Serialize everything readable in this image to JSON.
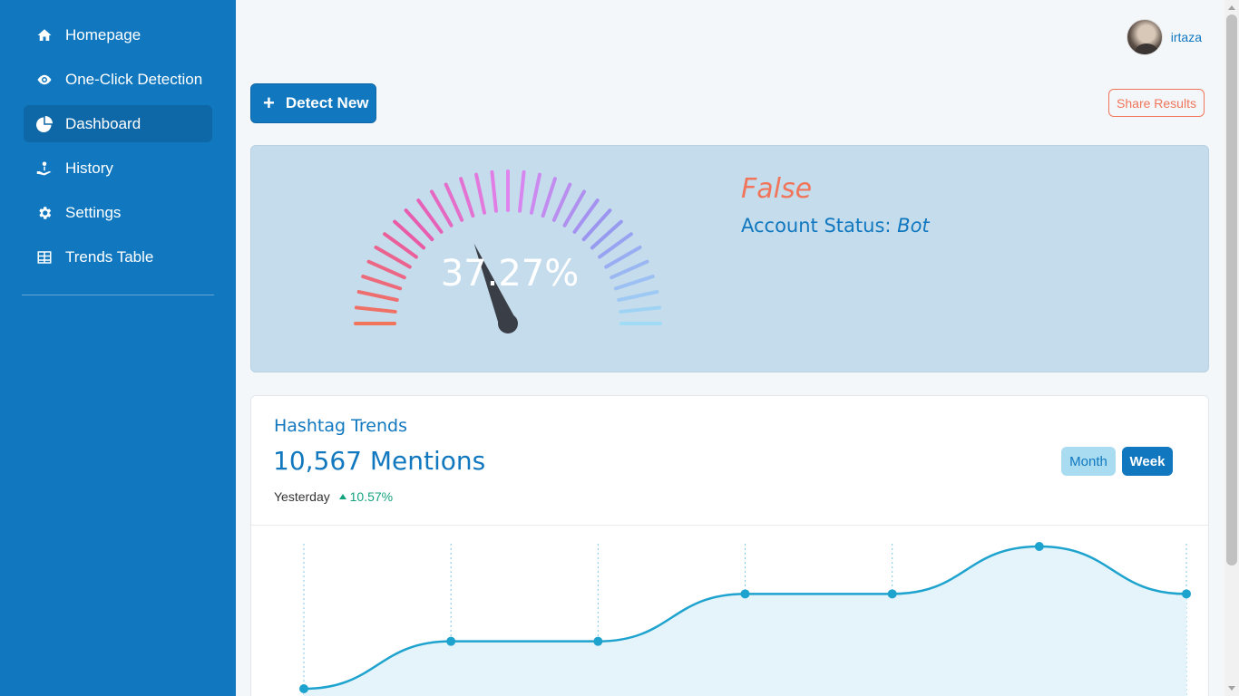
{
  "sidebar": {
    "items": [
      {
        "label": "Homepage",
        "icon": "home-icon"
      },
      {
        "label": "One-Click Detection",
        "icon": "eye-icon"
      },
      {
        "label": "Dashboard",
        "icon": "pie-chart-icon",
        "active": true
      },
      {
        "label": "History",
        "icon": "hand-holding-icon"
      },
      {
        "label": "Settings",
        "icon": "gear-icon"
      },
      {
        "label": "Trends Table",
        "icon": "table-icon"
      }
    ]
  },
  "header": {
    "username": "irtaza"
  },
  "actions": {
    "detect_label": "Detect New",
    "detect_icon": "+",
    "share_label": "Share Results"
  },
  "result": {
    "gauge_value": "37.27%",
    "gauge_percent": 37.27,
    "label": "False",
    "status_label": "Account Status:",
    "status_value": "Bot"
  },
  "trends": {
    "title": "Hashtag Trends",
    "mentions": "10,567 Mentions",
    "period": "Yesterday",
    "change": "10.57%",
    "toggle_month": "Month",
    "toggle_week": "Week"
  },
  "chart_data": {
    "type": "area",
    "x": [
      1,
      2,
      3,
      4,
      5,
      6,
      7
    ],
    "values": [
      0,
      2,
      2,
      4,
      4,
      6,
      4
    ],
    "ylim": [
      0,
      6
    ],
    "color": "#1ea3cf",
    "grid": "vertical-dotted"
  },
  "colors": {
    "primary": "#1178bf",
    "accent": "#f0755a",
    "success": "#14a37f"
  }
}
